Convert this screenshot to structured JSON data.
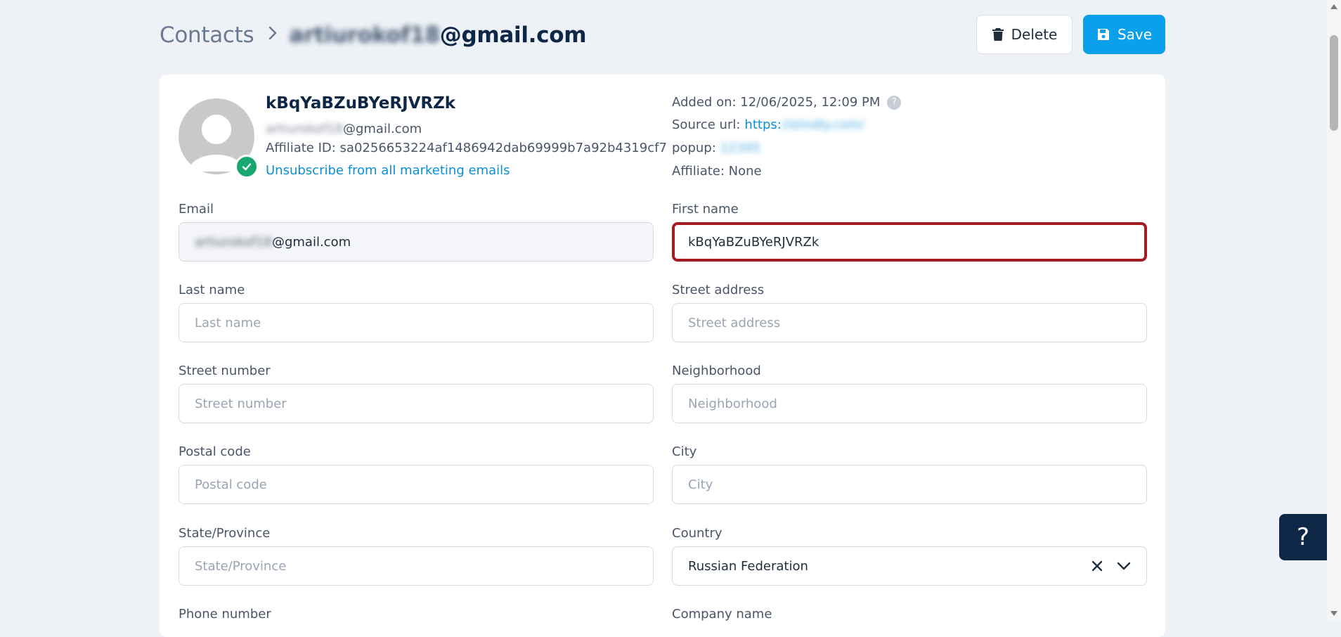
{
  "breadcrumb": {
    "root": "Contacts",
    "current_blurred": "artiurokof18",
    "current_domain": "@gmail.com"
  },
  "toolbar": {
    "delete_label": "Delete",
    "save_label": "Save"
  },
  "profile": {
    "name": "kBqYaBZuBYeRJVRZk",
    "email_blurred": "artiurokof18",
    "email_domain": "@gmail.com",
    "affiliate_id": "Affiliate ID: sa0256653224af1486942dab69999b7a92b4319cf7",
    "unsubscribe_label": "Unsubscribe from all marketing emails"
  },
  "meta": {
    "added_on": "Added on: 12/06/2025, 12:09 PM",
    "help_glyph": "?",
    "source_label": "Source url:",
    "source_link": "https:",
    "source_link_blurred": "//slindly.com/",
    "popup_label": "popup:",
    "popup_blurred": "12345",
    "affiliate": "Affiliate: None"
  },
  "form": {
    "email": {
      "label": "Email",
      "value_blurred": "artiurokof18",
      "value_domain": "@gmail.com"
    },
    "first_name": {
      "label": "First name",
      "value": "kBqYaBZuBYeRJVRZk"
    },
    "last_name": {
      "label": "Last name",
      "placeholder": "Last name"
    },
    "street_address": {
      "label": "Street address",
      "placeholder": "Street address"
    },
    "street_number": {
      "label": "Street number",
      "placeholder": "Street number"
    },
    "neighborhood": {
      "label": "Neighborhood",
      "placeholder": "Neighborhood"
    },
    "postal_code": {
      "label": "Postal code",
      "placeholder": "Postal code"
    },
    "city": {
      "label": "City",
      "placeholder": "City"
    },
    "state": {
      "label": "State/Province",
      "placeholder": "State/Province"
    },
    "country": {
      "label": "Country",
      "value": "Russian Federation"
    },
    "phone": {
      "label": "Phone number"
    },
    "company": {
      "label": "Company name"
    }
  },
  "help_button": {
    "glyph": "?"
  },
  "colors": {
    "primary": "#0aa0ea",
    "navy": "#0f2747",
    "focus_border": "#a51c24",
    "verified": "#16a772",
    "link": "#0a8fd6"
  },
  "icons": [
    "chevron-right-icon",
    "trash-icon",
    "save-icon",
    "avatar-icon",
    "check-icon",
    "help-icon",
    "clear-icon",
    "chevron-down-icon"
  ]
}
